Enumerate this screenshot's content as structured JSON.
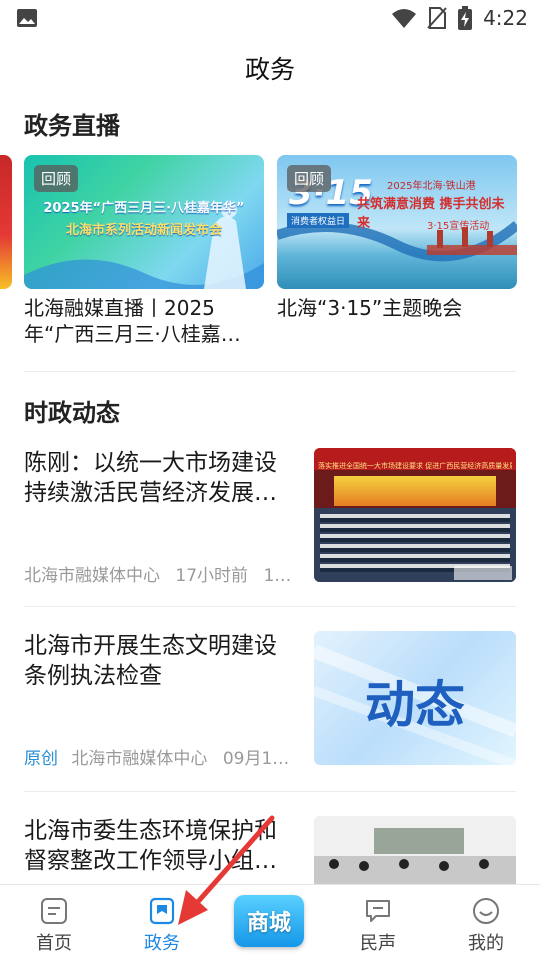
{
  "status_bar": {
    "time": "4:22"
  },
  "header": {
    "title": "政务"
  },
  "live_section": {
    "heading": "政务直播",
    "badge": "回顾",
    "items": [
      {
        "title": "北海融媒直播丨2025年“广西三月三·八桂嘉…",
        "thumb_title": "2025年“广西三月三·八桂嘉年华”",
        "thumb_subtitle": "北海市系列活动新闻发布会"
      },
      {
        "title": "北海“3·15”主题晚会",
        "thumb_year": "2025年北海·铁山港",
        "thumb_big": "3·15",
        "thumb_slogan": "共筑满意消费 携手共创未来",
        "thumb_sub": "3·15宣传活动",
        "thumb_tag": "消费者权益日"
      }
    ]
  },
  "news_section": {
    "heading": "时政动态",
    "items": [
      {
        "title": "陈刚：以统一大市场建设持续激活民营经济发展…",
        "source": "北海市融媒体中心",
        "time": "17小时前",
        "extra": "1…",
        "original": "",
        "thumb_banner": "落实推进全国统一大市场建设要求 促进广西民营经济高质量发展大会"
      },
      {
        "title": "北海市开展生态文明建设条例执法检查",
        "source": "北海市融媒体中心",
        "time": "09月1…",
        "extra": "",
        "original": "原创",
        "thumb_text": "动态"
      },
      {
        "title": "北海市委生态环境保护和督察整改工作领导小组…",
        "source": "",
        "time": "",
        "extra": "",
        "original": ""
      }
    ]
  },
  "tabbar": {
    "tabs": [
      {
        "label": "首页",
        "icon": "home-icon"
      },
      {
        "label": "政务",
        "icon": "bookmark-icon",
        "active": true
      },
      {
        "label": "商城",
        "icon": "mall-icon"
      },
      {
        "label": "民声",
        "icon": "chat-icon"
      },
      {
        "label": "我的",
        "icon": "smile-icon"
      }
    ]
  },
  "colors": {
    "accent": "#1e88e5",
    "text": "#1a1a1a",
    "meta": "#9a9a9a",
    "annotation_arrow": "#e53935"
  }
}
